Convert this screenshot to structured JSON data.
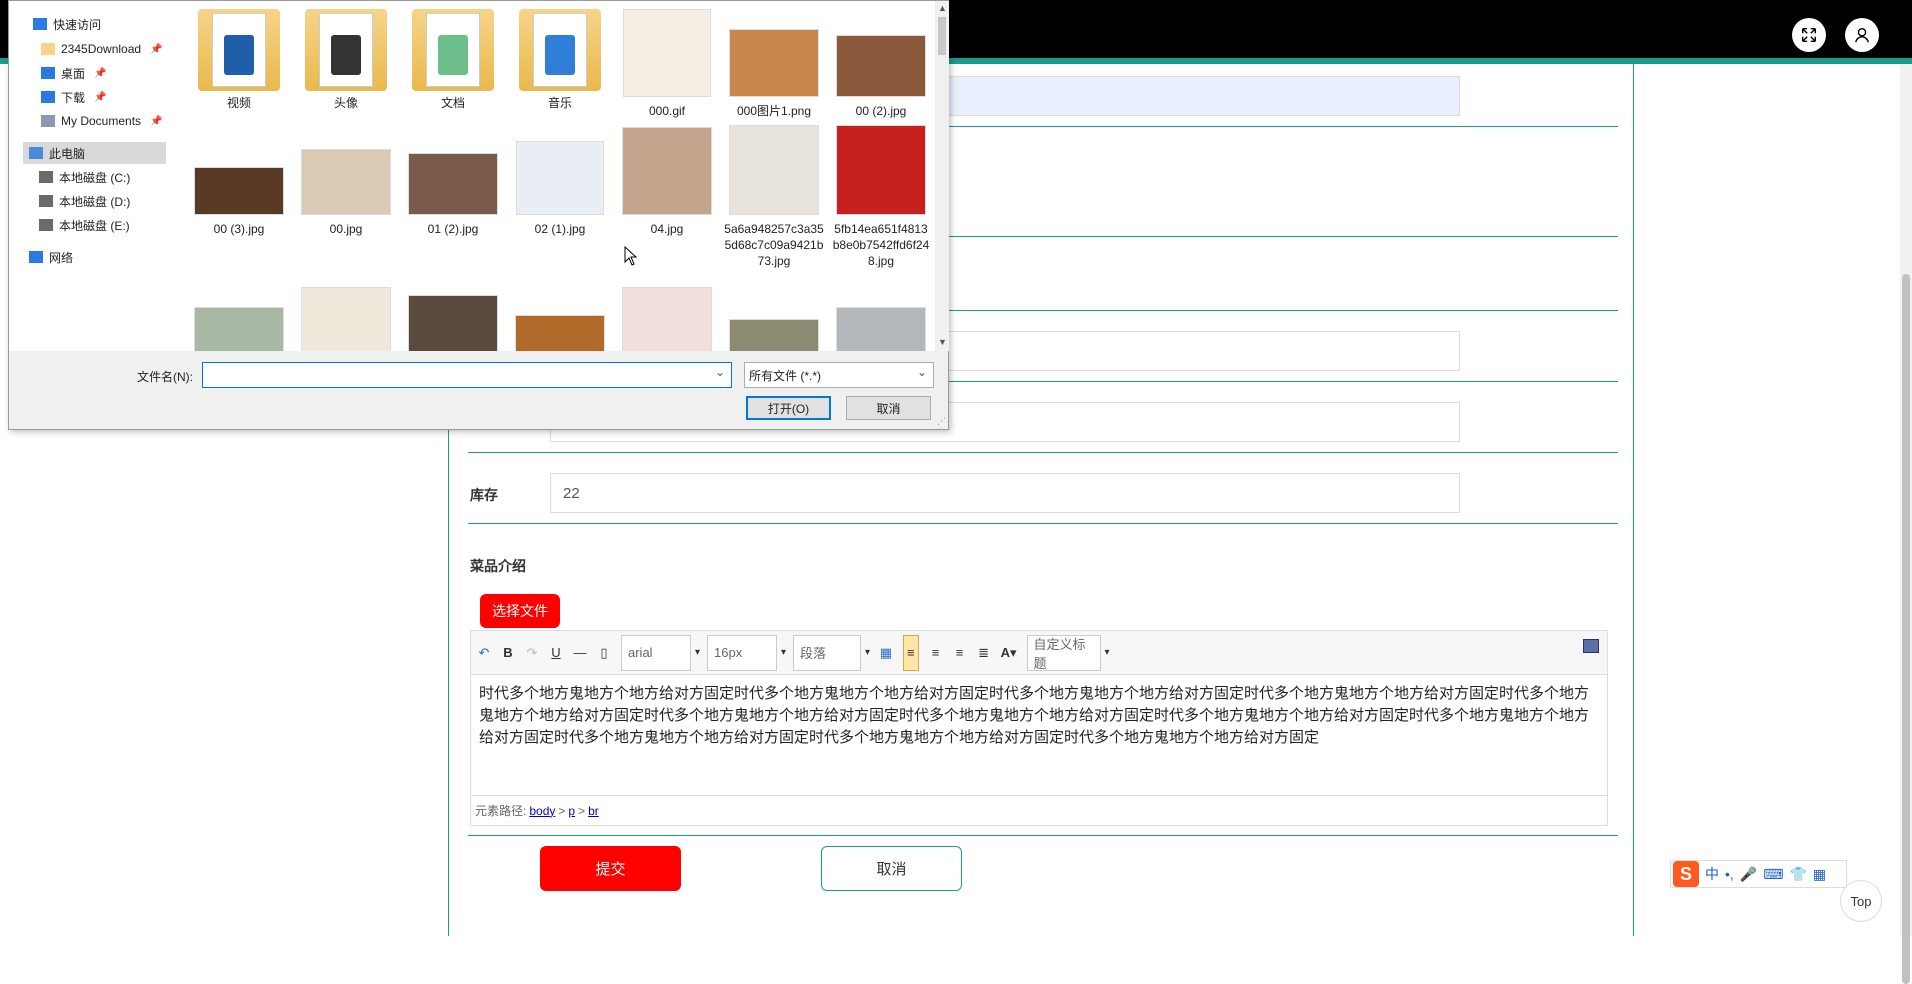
{
  "dialog": {
    "nav": [
      {
        "label": "快速访问",
        "icon": "star-icon",
        "pinned": false
      },
      {
        "label": "2345Download",
        "icon": "folder-icon",
        "pinned": true
      },
      {
        "label": "桌面",
        "icon": "desktop-icon",
        "pinned": true
      },
      {
        "label": "下载",
        "icon": "download-icon",
        "pinned": true
      },
      {
        "label": "My Documents",
        "icon": "documents-icon",
        "pinned": true
      },
      {
        "label": "此电脑",
        "icon": "computer-icon",
        "pinned": false,
        "selected": true
      },
      {
        "label": "本地磁盘 (C:)",
        "icon": "drive-icon"
      },
      {
        "label": "本地磁盘 (D:)",
        "icon": "drive-icon"
      },
      {
        "label": "本地磁盘 (E:)",
        "icon": "drive-icon"
      },
      {
        "label": "网络",
        "icon": "network-icon"
      }
    ],
    "files": [
      {
        "name": "视频",
        "kind": "folder",
        "badge_color": "#1f5ea8"
      },
      {
        "name": "头像",
        "kind": "folder",
        "badge_color": "#333333"
      },
      {
        "name": "文档",
        "kind": "folder",
        "badge_color": "#6cbf8b"
      },
      {
        "name": "音乐",
        "kind": "folder",
        "badge_color": "#2f7ed8"
      },
      {
        "name": "000.gif",
        "kind": "image",
        "color": "#f4efe2"
      },
      {
        "name": "000图片1.png",
        "kind": "image",
        "color": "#c9864a"
      },
      {
        "name": "00 (2).jpg",
        "kind": "image",
        "color": "#8b5a3c"
      },
      {
        "name": "00 (3).jpg",
        "kind": "image",
        "color": "#5a3a26"
      },
      {
        "name": "00.jpg",
        "kind": "image",
        "color": "#d9cbb4"
      },
      {
        "name": "01 (2).jpg",
        "kind": "image",
        "color": "#7a5a4a"
      },
      {
        "name": "02 (1).jpg",
        "kind": "image",
        "color": "#e9eef4"
      },
      {
        "name": "04.jpg",
        "kind": "image",
        "color": "#c4a48c"
      },
      {
        "name": "5a6a948257c3a355d68c7c09a9421b73.jpg",
        "kind": "image",
        "color": "#e8e4dc"
      },
      {
        "name": "5fb14ea651f4813b8e0b7542ffd6f248.jpg",
        "kind": "image",
        "color": "#c8201e"
      },
      {
        "name": "",
        "kind": "image",
        "color": "#a8b8a4"
      },
      {
        "name": "",
        "kind": "image",
        "color": "#efe9dc"
      },
      {
        "name": "",
        "kind": "image",
        "color": "#5b4a3e"
      },
      {
        "name": "",
        "kind": "image",
        "color": "#b06a2a"
      },
      {
        "name": "",
        "kind": "image",
        "color": "#f2dedc"
      },
      {
        "name": "",
        "kind": "image",
        "color": "#8c8a70"
      },
      {
        "name": "",
        "kind": "image",
        "color": "#b4b8bc"
      }
    ],
    "filename_label": "文件名(N):",
    "filename_value": "",
    "filter_label": "所有文件 (*.*)",
    "open_label": "打开(O)",
    "cancel_label": "取消"
  },
  "page": {
    "stock_label": "库存",
    "stock_value": "22",
    "intro_label": "菜品介绍",
    "choose_file_label": "选择文件",
    "editor": {
      "font": "arial",
      "size": "16px",
      "paragraph": "段落",
      "custom_title": "自定义标题",
      "content": "时代多个地方鬼地方个地方给对方固定时代多个地方鬼地方个地方给对方固定时代多个地方鬼地方个地方给对方固定时代多个地方鬼地方个地方给对方固定时代多个地方鬼地方个地方给对方固定时代多个地方鬼地方个地方给对方固定时代多个地方鬼地方个地方给对方固定时代多个地方鬼地方个地方给对方固定时代多个地方鬼地方个地方给对方固定时代多个地方鬼地方个地方给对方固定时代多个地方鬼地方个地方给对方固定时代多个地方鬼地方个地方给对方固定",
      "path_label": "元素路径:",
      "path": [
        "body",
        "p",
        "br"
      ]
    },
    "submit_label": "提交",
    "cancel_label": "取消",
    "top_label": "Top",
    "ime": [
      "中",
      "•,",
      "🎤",
      "⌨",
      "👕",
      "▦"
    ]
  },
  "colors": {
    "accent": "#1c9b8c",
    "primary_button": "#ff0000",
    "dialog_focus": "#0078d7"
  }
}
